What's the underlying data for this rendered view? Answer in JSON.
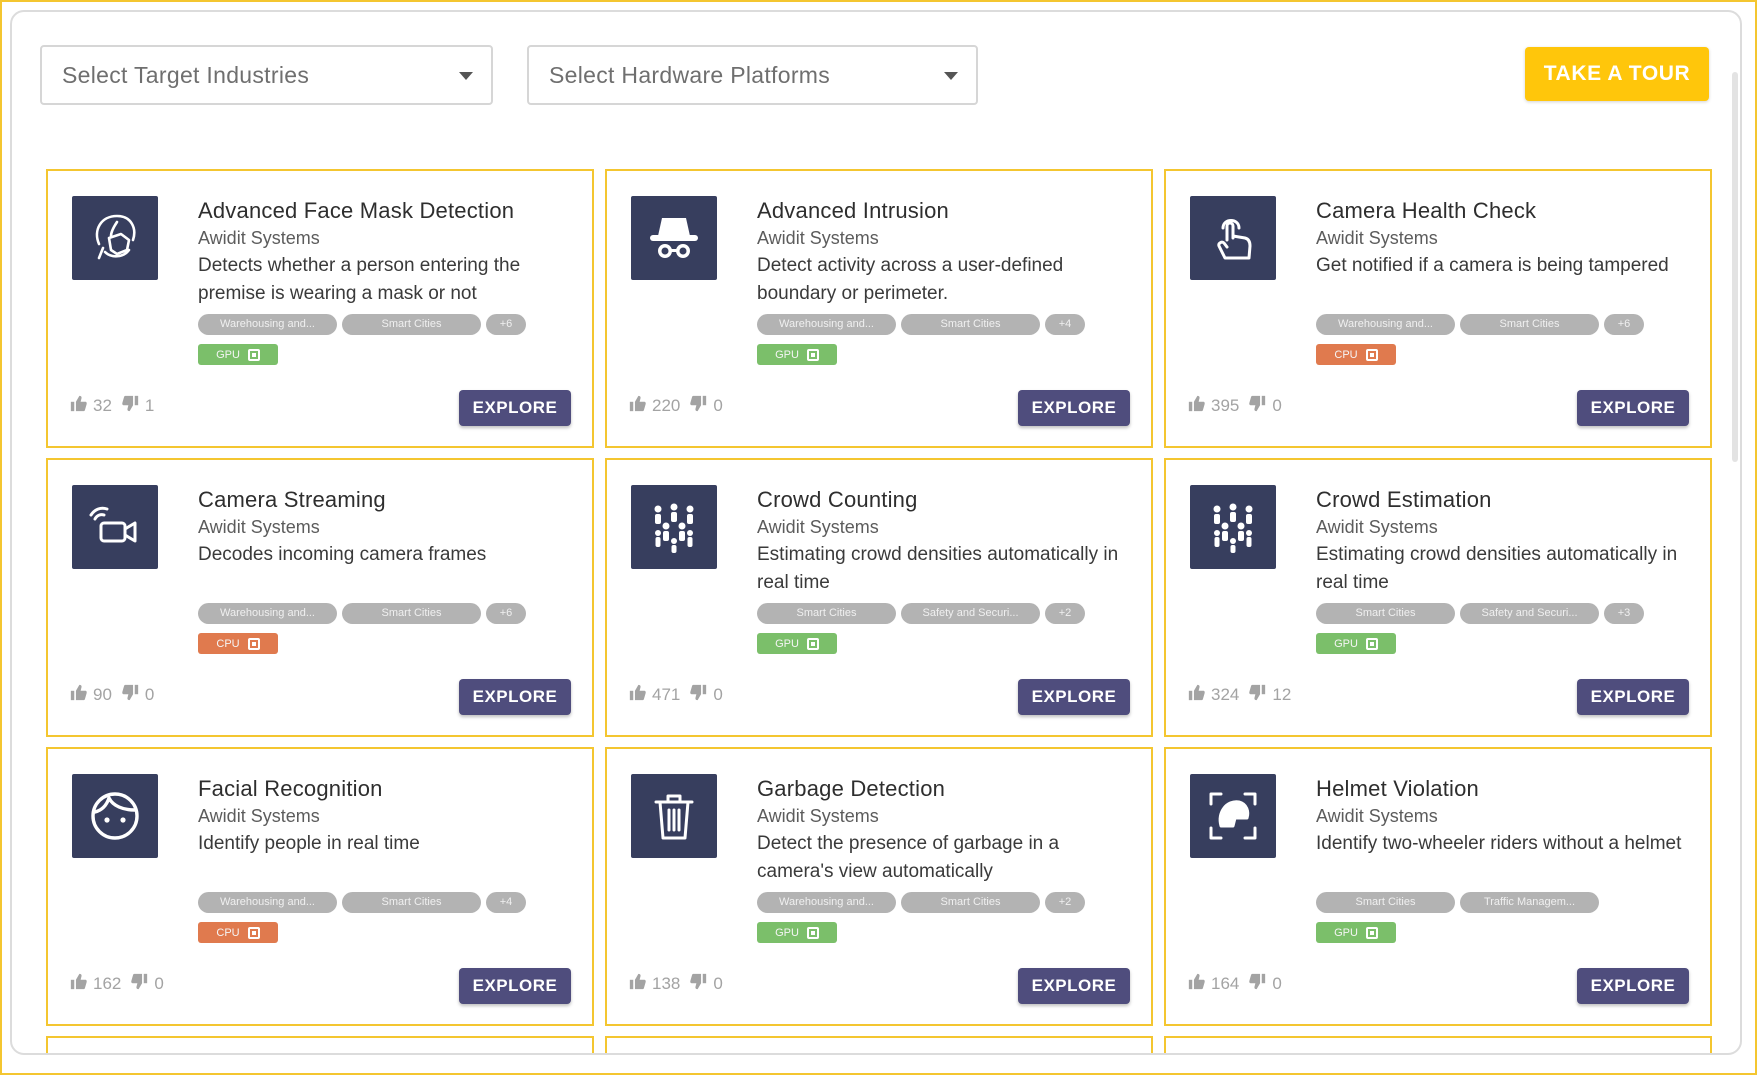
{
  "filters": {
    "industries_placeholder": "Select Target Industries",
    "hardware_placeholder": "Select Hardware Platforms"
  },
  "tour_button": "TAKE A TOUR",
  "colors": {
    "accent_yellow": "#ffc60b",
    "card_border": "#f4c630",
    "explore_button": "#4f4d7d",
    "thumb_bg": "#373e5e",
    "tag_gray": "#b3b3b3",
    "gpu_green": "#7bbf6a",
    "cpu_orange": "#e07a4e"
  },
  "explore_label": "EXPLORE",
  "cards": [
    {
      "title": "Advanced Face Mask Detection",
      "vendor": "Awidit Systems",
      "description": "Detects whether a person entering the premise is wearing a mask or not",
      "icon": "face-mask-icon",
      "tags": [
        "Warehousing and...",
        "Smart Cities",
        "+6"
      ],
      "hardware": "GPU",
      "likes": "32",
      "dislikes": "1"
    },
    {
      "title": "Advanced Intrusion",
      "vendor": "Awidit Systems",
      "description": "Detect activity across a user-defined boundary or perimeter.",
      "icon": "incognito-icon",
      "tags": [
        "Warehousing and...",
        "Smart Cities",
        "+4"
      ],
      "hardware": "GPU",
      "likes": "220",
      "dislikes": "0"
    },
    {
      "title": "Camera Health Check",
      "vendor": "Awidit Systems",
      "description": "Get notified if a camera is being tampered",
      "icon": "touch-hand-icon",
      "tags": [
        "Warehousing and...",
        "Smart Cities",
        "+6"
      ],
      "hardware": "CPU",
      "likes": "395",
      "dislikes": "0"
    },
    {
      "title": "Camera Streaming",
      "vendor": "Awidit Systems",
      "description": "Decodes incoming camera frames",
      "icon": "video-camera-icon",
      "tags": [
        "Warehousing and...",
        "Smart Cities",
        "+6"
      ],
      "hardware": "CPU",
      "likes": "90",
      "dislikes": "0"
    },
    {
      "title": "Crowd Counting",
      "vendor": "Awidit Systems",
      "description": "Estimating crowd densities automatically in real time",
      "icon": "crowd-icon",
      "tags": [
        "Smart Cities",
        "Safety and Securi...",
        "+2"
      ],
      "hardware": "GPU",
      "likes": "471",
      "dislikes": "0"
    },
    {
      "title": "Crowd Estimation",
      "vendor": "Awidit Systems",
      "description": "Estimating crowd densities automatically in real time",
      "icon": "crowd-icon",
      "tags": [
        "Smart Cities",
        "Safety and Securi...",
        "+3"
      ],
      "hardware": "GPU",
      "likes": "324",
      "dislikes": "12"
    },
    {
      "title": "Facial Recognition",
      "vendor": "Awidit Systems",
      "description": "Identify people in real time",
      "icon": "face-icon",
      "tags": [
        "Warehousing and...",
        "Smart Cities",
        "+4"
      ],
      "hardware": "CPU",
      "likes": "162",
      "dislikes": "0"
    },
    {
      "title": "Garbage Detection",
      "vendor": "Awidit Systems",
      "description": "Detect the presence of garbage in a camera's view automatically",
      "icon": "trash-icon",
      "tags": [
        "Warehousing and...",
        "Smart Cities",
        "+2"
      ],
      "hardware": "GPU",
      "likes": "138",
      "dislikes": "0"
    },
    {
      "title": "Helmet Violation",
      "vendor": "Awidit Systems",
      "description": "Identify two-wheeler riders without a helmet",
      "icon": "helmet-icon",
      "tags": [
        "Smart Cities",
        "Traffic Managem..."
      ],
      "hardware": "GPU",
      "likes": "164",
      "dislikes": "0"
    }
  ]
}
